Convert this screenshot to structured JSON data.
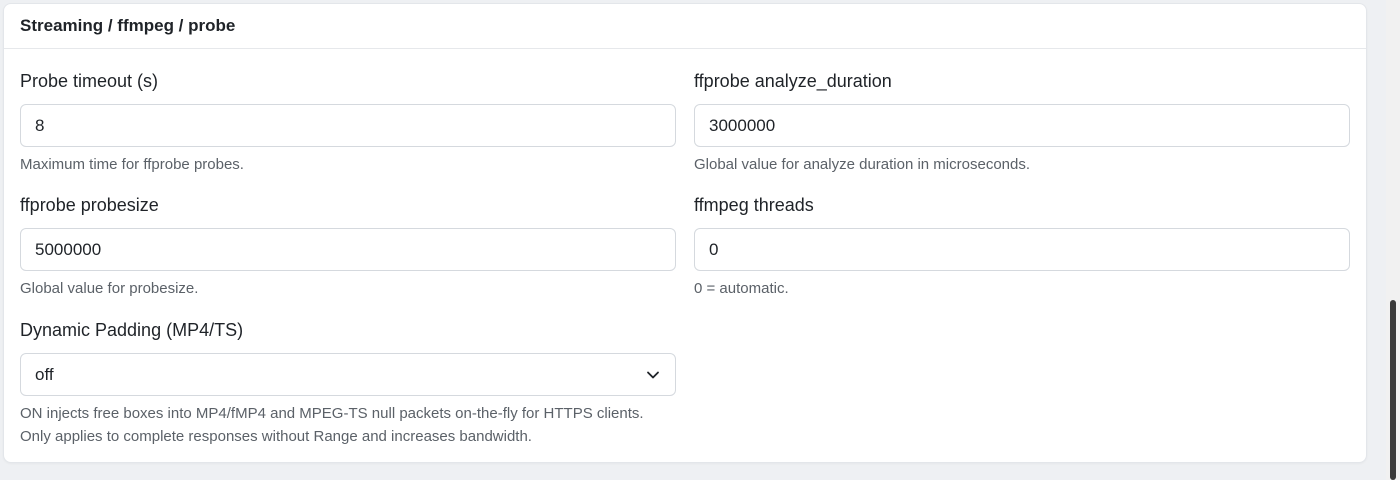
{
  "section": {
    "title": "Streaming / ffmpeg / probe"
  },
  "fields": {
    "probe_timeout": {
      "label": "Probe timeout (s)",
      "value": "8",
      "help": "Maximum time for ffprobe probes."
    },
    "analyze_duration": {
      "label": "ffprobe analyze_duration",
      "value": "3000000",
      "help": "Global value for analyze duration in microseconds."
    },
    "probesize": {
      "label": "ffprobe probesize",
      "value": "5000000",
      "help": "Global value for probesize."
    },
    "threads": {
      "label": "ffmpeg threads",
      "value": "0",
      "help": "0 = automatic."
    },
    "dynamic_padding": {
      "label": "Dynamic Padding (MP4/TS)",
      "selected": "off",
      "help_line1": "ON injects free boxes into MP4/fMP4 and MPEG-TS null packets on-the-fly for HTTPS clients.",
      "help_line2": "Only applies to complete responses without Range and increases bandwidth."
    }
  },
  "icons": {
    "select_chevron": "chevron-down-icon"
  },
  "colors": {
    "page_background": "#eef0f3",
    "card_background": "#ffffff",
    "input_border": "#d5d9de",
    "help_text": "#5b6168"
  }
}
